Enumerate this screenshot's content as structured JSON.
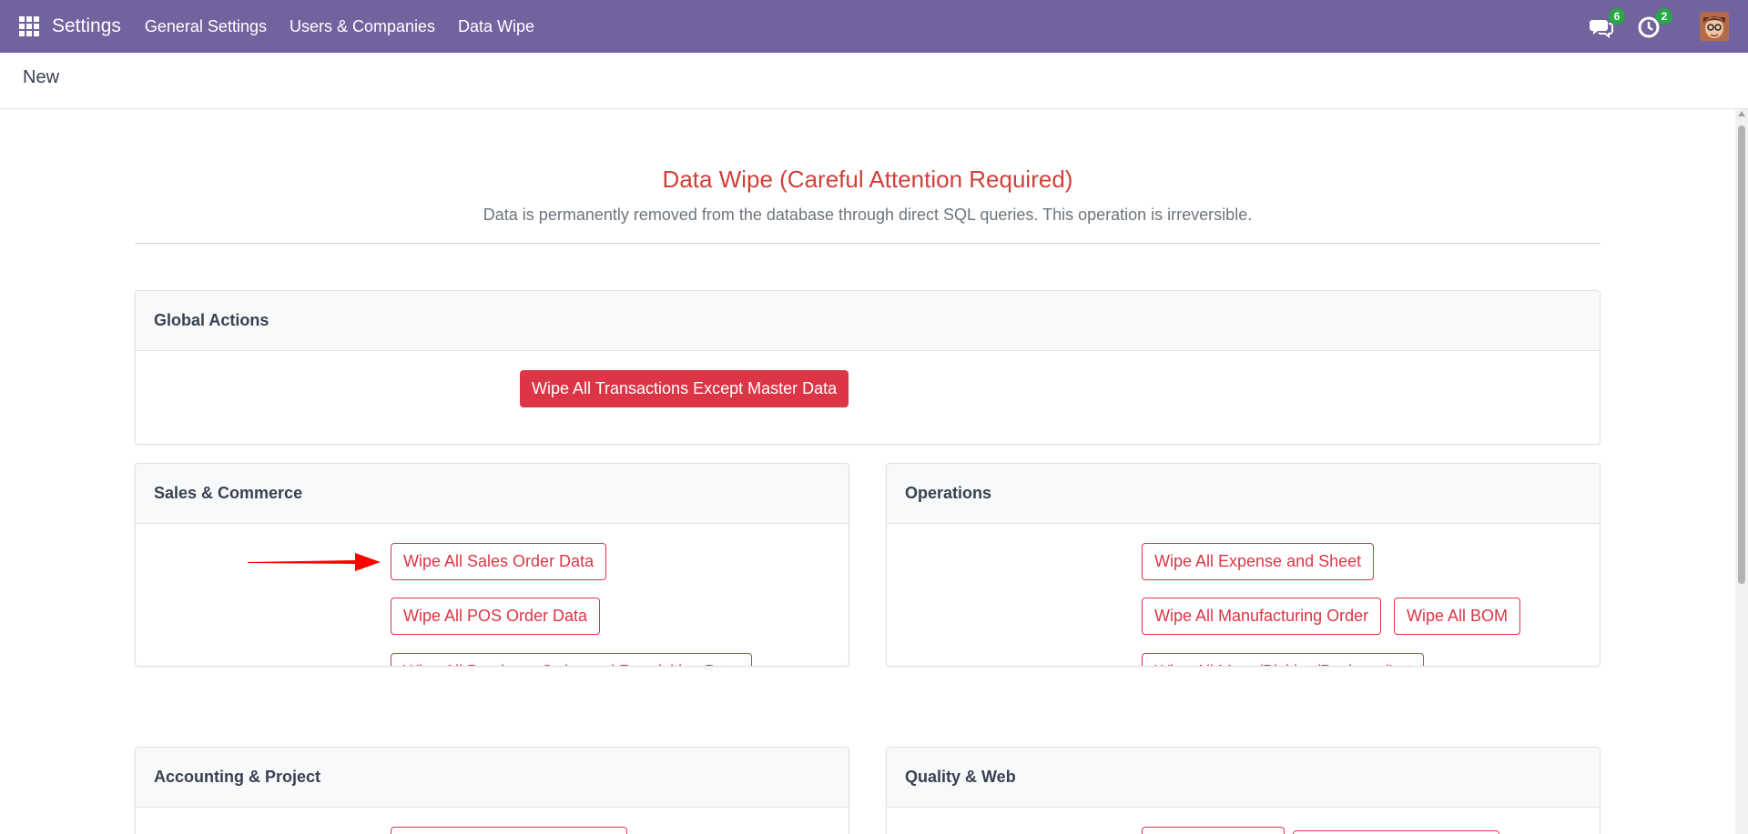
{
  "navbar": {
    "brand": "Settings",
    "menu": [
      "General Settings",
      "Users & Companies",
      "Data Wipe"
    ],
    "messages_count": "6",
    "activities_count": "2",
    "icons": [
      "apps-grid-icon",
      "chat-icon",
      "clock-icon",
      "avatar"
    ]
  },
  "breadcrumb": "New",
  "page": {
    "title": "Data Wipe (Careful Attention Required)",
    "subtitle": "Data is permanently removed from the database through direct SQL queries. This operation is irreversible."
  },
  "sections": {
    "global": {
      "title": "Global Actions",
      "buttons": [
        "Wipe All Transactions Except Master Data"
      ]
    },
    "sales": {
      "title": "Sales & Commerce",
      "buttons": [
        "Wipe All Sales Order Data",
        "Wipe All POS Order Data",
        "Wipe All Purchase Order and Requisition Data"
      ]
    },
    "operations": {
      "title": "Operations",
      "buttons": [
        "Wipe All Expense and Sheet",
        "Wipe All Manufacturing Order",
        "Wipe All BOM",
        "Wipe All Move/Picking/Package/Lot"
      ]
    },
    "accounting": {
      "title": "Accounting & Project"
    },
    "quality": {
      "title": "Quality & Web"
    }
  },
  "colors": {
    "navbar": "#71639e",
    "danger": "#dc3545",
    "title": "#d23f3a",
    "badge": "#28a745"
  }
}
